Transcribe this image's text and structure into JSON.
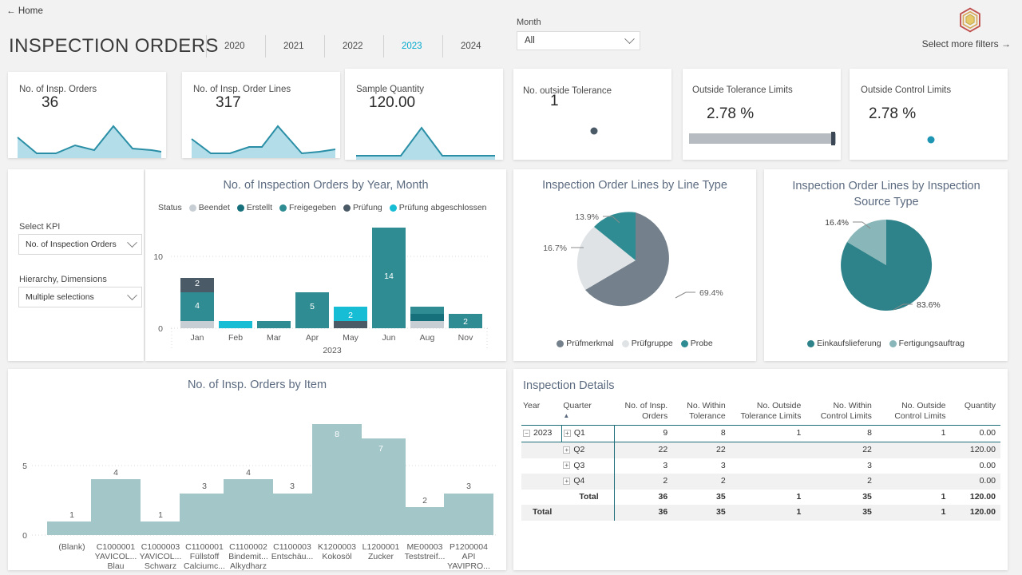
{
  "header": {
    "home_label": "← Home",
    "title": "INSPECTION ORDERS",
    "years": [
      {
        "label": "2020",
        "active": false
      },
      {
        "label": "2021",
        "active": false
      },
      {
        "label": "2022",
        "active": false
      },
      {
        "label": "2023",
        "active": true
      },
      {
        "label": "2024",
        "active": false
      }
    ],
    "month_filter": {
      "label": "Month",
      "value": "All",
      "placeholder": "All"
    },
    "more_filters": "Select more filters →"
  },
  "kpis": [
    {
      "label": "No. of Insp. Orders",
      "value": "36",
      "visual": "sparkline"
    },
    {
      "label": "No. of Insp. Order Lines",
      "value": "317",
      "visual": "sparkline"
    },
    {
      "label": "Sample Quantity",
      "value": "120.00",
      "visual": "sparkline"
    },
    {
      "label": "No. outside Tolerance",
      "value": "1",
      "visual": "dot-dark"
    },
    {
      "label": "Outside Tolerance Limits",
      "value": "2.78 %",
      "visual": "bar"
    },
    {
      "label": "Outside Control Limits",
      "value": "2.78 %",
      "visual": "dot-teal"
    }
  ],
  "selectors": {
    "kpi_label": "Select KPI",
    "kpi_value": "No. of Inspection Orders",
    "hierarchy_label": "Hierarchy, Dimensions",
    "hierarchy_value": "Multiple selections"
  },
  "colors": {
    "beendet": "#c8cfd4",
    "erstellt": "#15707b",
    "freigegeben": "#2e8c92",
    "pruefung": "#4a5a66",
    "pruefung_abgeschlossen": "#16bdd4",
    "pruefmerkmal": "#74808c",
    "pruefgruppe": "#dfe3e5",
    "probe": "#2e8c92",
    "einkaufslieferung": "#2e8289",
    "fertigungsauftrag": "#88b6b9",
    "item_bar": "#a3c6c8",
    "accent": "#00a9cd"
  },
  "chart_data": [
    {
      "id": "orders-by-year-month",
      "type": "bar",
      "title": "No. of Inspection Orders by Year, Month",
      "legend_title": "Status",
      "legend_position": "top",
      "stacked": true,
      "xlabel": "2023",
      "ylabel": "",
      "ylim": [
        0,
        15
      ],
      "yticks": [
        "0",
        "10"
      ],
      "grid": true,
      "categories": [
        "Jan",
        "Feb",
        "Mar",
        "Apr",
        "May",
        "Jun",
        "Aug",
        "Nov"
      ],
      "series": [
        {
          "name": "Beendet",
          "color": "#c8cfd4",
          "values": [
            1,
            0,
            0,
            0,
            0,
            0,
            1,
            0
          ]
        },
        {
          "name": "Erstellt",
          "color": "#15707b",
          "values": [
            0,
            0,
            0,
            0,
            0,
            0,
            1,
            0
          ]
        },
        {
          "name": "Freigegeben",
          "color": "#2e8c92",
          "values": [
            4,
            0,
            1,
            5,
            0,
            14,
            1,
            2
          ]
        },
        {
          "name": "Prüfung",
          "color": "#4a5a66",
          "values": [
            2,
            0,
            0,
            0,
            1,
            0,
            0,
            0
          ]
        },
        {
          "name": "Prüfung abgeschlossen",
          "color": "#16bdd4",
          "values": [
            0,
            1,
            0,
            0,
            2,
            0,
            0,
            0
          ]
        }
      ],
      "data_labels": {
        "Jan": [
          "4",
          "2"
        ],
        "Apr": [
          "5"
        ],
        "May": [
          "2"
        ],
        "Jun": [
          "14"
        ],
        "Nov": [
          "2"
        ]
      }
    },
    {
      "id": "lines-by-line-type",
      "type": "pie",
      "title": "Inspection Order Lines by Line Type",
      "legend_position": "bottom",
      "labels": [
        "Prüfmerkmal",
        "Prüfgruppe",
        "Probe"
      ],
      "values": [
        69.4,
        16.7,
        13.9
      ],
      "value_labels": [
        "69.4%",
        "16.7%",
        "13.9%"
      ],
      "colors": [
        "#74808c",
        "#dfe3e5",
        "#2e8c92"
      ]
    },
    {
      "id": "lines-by-inspection-source-type",
      "type": "pie",
      "title": "Inspection Order Lines by Inspection Source Type",
      "legend_position": "bottom",
      "labels": [
        "Einkaufslieferung",
        "Fertigungsauftrag"
      ],
      "values": [
        83.6,
        16.4
      ],
      "value_labels": [
        "83.6%",
        "16.4%"
      ],
      "colors": [
        "#2e8289",
        "#88b6b9"
      ]
    },
    {
      "id": "orders-by-item",
      "type": "bar",
      "title": "No. of Insp. Orders by Item",
      "stacked": false,
      "xlabel": "",
      "ylabel": "",
      "ylim": [
        0,
        9
      ],
      "yticks": [
        "0",
        "5"
      ],
      "grid": true,
      "categories": [
        "(Blank)",
        "C1000001 YAVICOL... Blau",
        "C1000003 YAVICOL... Schwarz",
        "C1100001 Füllstoff Calciumc...",
        "C1100002 Bindemit... Alkydharz",
        "C1100003 Entschäu...",
        "K1200003 Kokosöl",
        "L1200001 Zucker",
        "ME00003 Teststreif...",
        "P1200004 API YAVIPRO..."
      ],
      "category_lines": [
        [
          "(Blank)"
        ],
        [
          "C1000001",
          "YAVICOL...",
          "Blau"
        ],
        [
          "C1000003",
          "YAVICOL...",
          "Schwarz"
        ],
        [
          "C1100001",
          "Füllstoff",
          "Calciumc..."
        ],
        [
          "C1100002",
          "Bindemit...",
          "Alkydharz"
        ],
        [
          "C1100003",
          "Entschäu..."
        ],
        [
          "K1200003",
          "Kokosöl"
        ],
        [
          "L1200001",
          "Zucker"
        ],
        [
          "ME00003",
          "Teststreif..."
        ],
        [
          "P1200004",
          "API",
          "YAVIPRO..."
        ]
      ],
      "values": [
        1,
        4,
        1,
        3,
        4,
        3,
        8,
        7,
        2,
        3
      ],
      "color": "#a3c6c8"
    }
  ],
  "details": {
    "title": "Inspection Details",
    "sort_column": "Quarter",
    "columns": [
      "Year",
      "Quarter",
      "No. of Insp. Orders",
      "No. Within Tolerance",
      "No. Outside Tolerance Limits",
      "No. Within Control Limits",
      "No. Outside Control Limits",
      "Quantity"
    ],
    "column_lines": [
      [
        "Year"
      ],
      [
        "Quarter"
      ],
      [
        "No. of Insp.",
        "Orders"
      ],
      [
        "No. Within",
        "Tolerance"
      ],
      [
        "No. Outside",
        "Tolerance Limits"
      ],
      [
        "No. Within",
        "Control Limits"
      ],
      [
        "No. Outside",
        "Control Limits"
      ],
      [
        "Quantity"
      ]
    ],
    "rows": [
      {
        "year": "2023",
        "quarter": "Q1",
        "orders": "9",
        "within_tol": "8",
        "outside_tol": "1",
        "within_ctrl": "8",
        "outside_ctrl": "1",
        "quantity": "0.00",
        "expandable": true,
        "year_expander": "−"
      },
      {
        "year": "",
        "quarter": "Q2",
        "orders": "22",
        "within_tol": "22",
        "outside_tol": "",
        "within_ctrl": "22",
        "outside_ctrl": "",
        "quantity": "120.00",
        "expandable": true
      },
      {
        "year": "",
        "quarter": "Q3",
        "orders": "3",
        "within_tol": "3",
        "outside_tol": "",
        "within_ctrl": "3",
        "outside_ctrl": "",
        "quantity": "0.00",
        "expandable": true
      },
      {
        "year": "",
        "quarter": "Q4",
        "orders": "2",
        "within_tol": "2",
        "outside_tol": "",
        "within_ctrl": "2",
        "outside_ctrl": "",
        "quantity": "0.00",
        "expandable": true
      },
      {
        "year": "",
        "quarter": "Total",
        "orders": "36",
        "within_tol": "35",
        "outside_tol": "1",
        "within_ctrl": "35",
        "outside_ctrl": "1",
        "quantity": "120.00",
        "expandable": false,
        "subtotal": true
      },
      {
        "year": "Total",
        "quarter": "",
        "orders": "36",
        "within_tol": "35",
        "outside_tol": "1",
        "within_ctrl": "35",
        "outside_ctrl": "1",
        "quantity": "120.00",
        "expandable": false,
        "grand": true
      }
    ]
  }
}
